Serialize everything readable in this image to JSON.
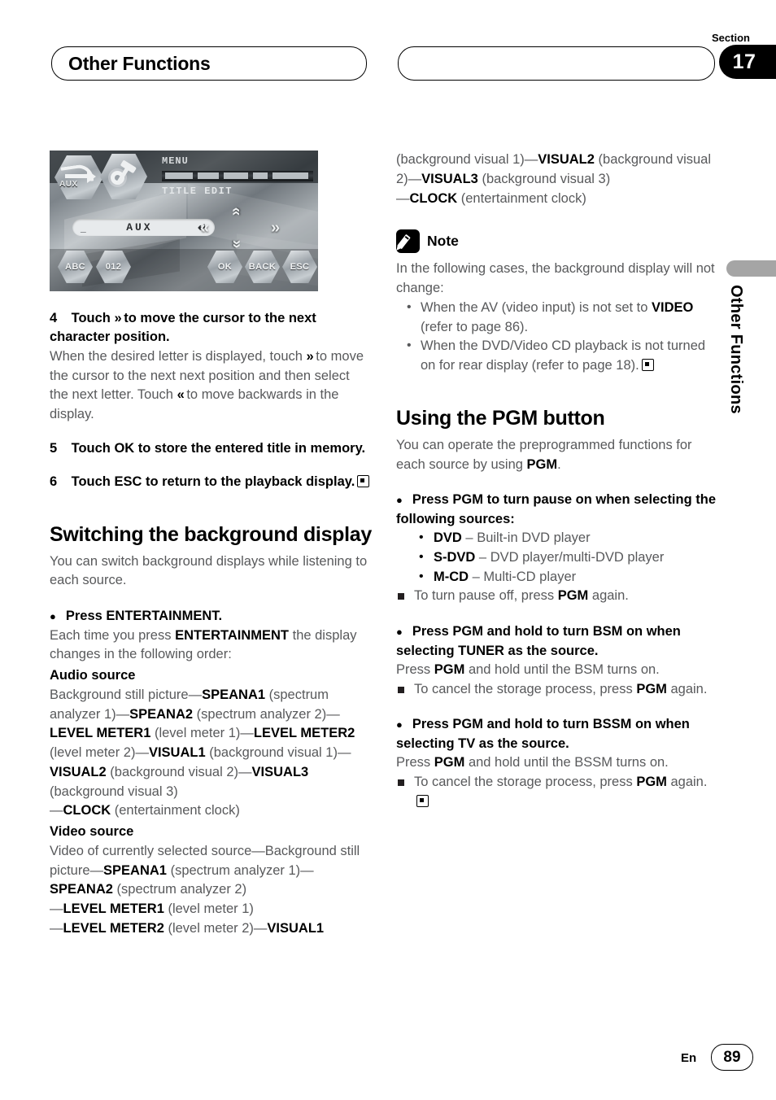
{
  "header": {
    "chapter_title": "Other Functions",
    "section_label": "Section",
    "section_number": "17"
  },
  "side_tab": {
    "label": "Other Functions"
  },
  "device_screenshot": {
    "alt": "head-unit title edit screen",
    "aux_button": "AUX",
    "menu_label": "MENU",
    "title_edit_label": "TITLE EDIT",
    "input_cursor": "_",
    "input_text": "AUX",
    "input_return_glyph": "↵",
    "chevron_up": "»",
    "chevron_down": "»",
    "chevron_left": "«",
    "chevron_right": "»",
    "buttons": [
      "ABC",
      "012",
      "OK",
      "BACK",
      "ESC"
    ]
  },
  "left_column": {
    "step4": {
      "number": "4",
      "title_a": "Touch",
      "glyph": "»",
      "title_b": "to move the cursor to the next character position.",
      "body_a": "When the desired letter is displayed, touch",
      "glyph_fwd": "»",
      "body_b": "to move the cursor to the next next position and then select the next letter. Touch",
      "glyph_back": "«",
      "body_c": "to move backwards in the display."
    },
    "step5": {
      "number": "5",
      "text": "Touch OK to store the entered title in memory."
    },
    "step6": {
      "number": "6",
      "text": "Touch ESC to return to the playback display."
    },
    "heading": "Switching the background display",
    "intro": "You can switch background displays while listening to each source.",
    "bullet_press": "Press ENTERTAINMENT.",
    "bullet_press_body_a": "Each time you press",
    "bullet_press_body_bold": "ENTERTAINMENT",
    "bullet_press_body_b": "the display changes in the following order:",
    "audio_source_label": "Audio source",
    "audio_chain": [
      {
        "plain": "Background still picture—",
        "bold": "SPEANA1",
        "after": " (spectrum analyzer 1)—"
      },
      {
        "plain": "",
        "bold": "SPEANA2",
        "after": " (spectrum analyzer 2)—"
      },
      {
        "plain": "",
        "bold": "LEVEL METER1",
        "after": " (level meter 1)"
      },
      {
        "plain": "—",
        "bold": "LEVEL METER2",
        "after": " (level meter 2)—"
      },
      {
        "plain": "",
        "bold": "VISUAL1",
        "after": " (background visual 1)—"
      }
    ],
    "video_source_label": "Video source",
    "video_chain_intro": "Video of currently selected source—Background still picture—",
    "video_chain": [
      {
        "bold": "SPEANA1",
        "after": " (spectrum analyzer 1)—"
      },
      {
        "bold": "SPEANA2",
        "after": " (spectrum analyzer 2)"
      },
      {
        "bold": "LEVEL METER1",
        "after": " (level meter 1)",
        "lead": "—"
      },
      {
        "bold": "LEVEL METER2",
        "after": " (level meter 2)—",
        "lead": "—"
      },
      {
        "bold": "VISUAL1",
        "after": ""
      }
    ]
  },
  "right_column": {
    "continued_chain": [
      {
        "plain": "(background visual 1)—",
        "bold": "VISUAL2",
        "after": " (background visual 2)—"
      },
      {
        "plain": "",
        "bold": "VISUAL3",
        "after": " (background visual 3)"
      },
      {
        "plain": "—",
        "bold": "CLOCK",
        "after": " (entertainment clock)"
      }
    ],
    "note": {
      "title": "Note",
      "intro": "In the following cases, the background display will not change:",
      "items": [
        {
          "a": "When the AV (video input) is not set to ",
          "bold": "VIDEO",
          "b": " (refer to page 86)."
        },
        {
          "a": "When the DVD/Video CD playback is not turned on for rear display (refer to page 18).",
          "bold": "",
          "b": ""
        }
      ]
    },
    "heading": "Using the PGM button",
    "intro_a": "You can operate the preprogrammed functions for each source by using ",
    "intro_bold": "PGM",
    "intro_b": ".",
    "bullet1": "Press PGM to turn pause on when selecting the following sources:",
    "sources": [
      {
        "bold": "DVD",
        "desc": " – Built-in DVD player"
      },
      {
        "bold": "S-DVD",
        "desc": " – DVD player/multi-DVD player"
      },
      {
        "bold": "M-CD",
        "desc": " – Multi-CD player"
      }
    ],
    "note1_a": "To turn pause off, press ",
    "note1_bold": "PGM",
    "note1_b": " again.",
    "bullet2": "Press PGM and hold to turn BSM on when selecting TUNER as the source.",
    "bullet2_body_a": "Press ",
    "bullet2_body_bold": "PGM",
    "bullet2_body_b": " and hold until the BSM turns on.",
    "bullet2_note_a": "To cancel the storage process, press ",
    "bullet2_note_bold": "PGM",
    "bullet2_note_b": " again.",
    "bullet3": "Press PGM and hold to turn BSSM on when selecting TV as the source.",
    "bullet3_body_a": "Press ",
    "bullet3_body_bold": "PGM",
    "bullet3_body_b": " and hold until the BSSM turns on.",
    "bullet3_note_a": "To cancel the storage process, press ",
    "bullet3_note_bold": "PGM",
    "bullet3_note_b": " again."
  },
  "footer": {
    "language": "En",
    "page_number": "89"
  }
}
